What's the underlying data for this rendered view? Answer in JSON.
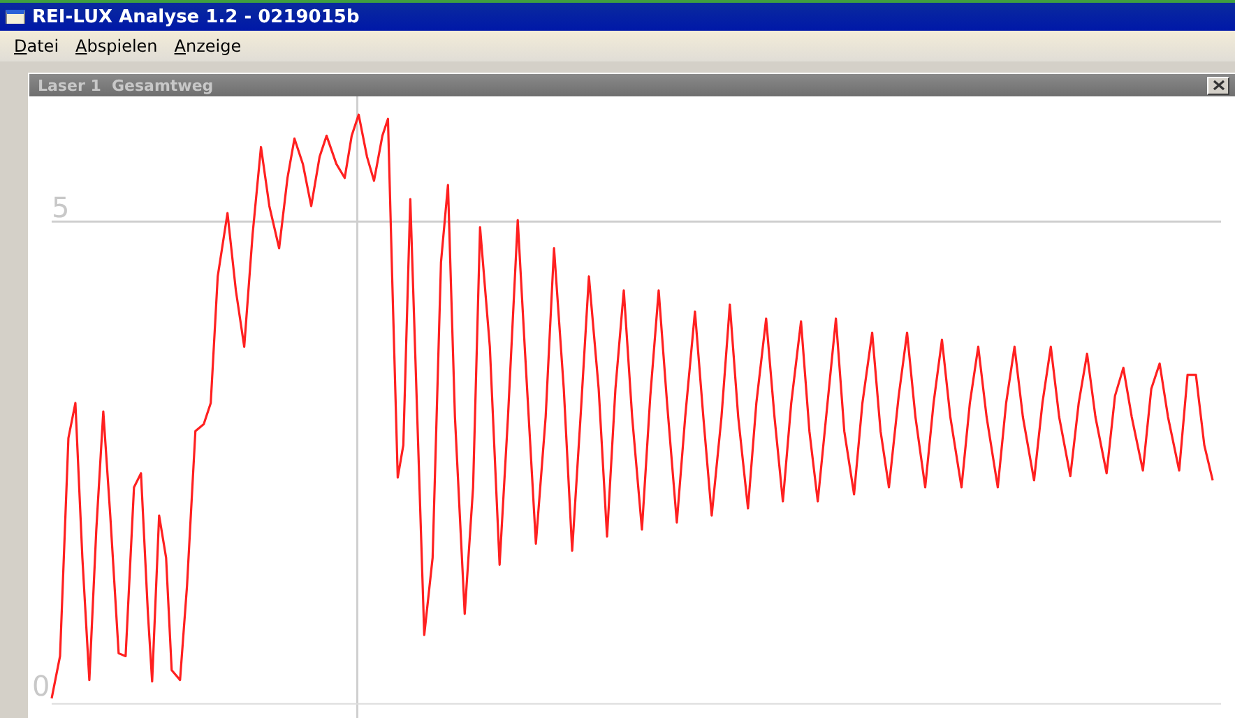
{
  "window": {
    "title": "REI-LUX Analyse 1.2 - 0219015b"
  },
  "menu": [
    {
      "label": "Datei"
    },
    {
      "label": "Abspielen"
    },
    {
      "label": "Anzeige"
    }
  ],
  "child_window": {
    "title": "Laser 1  Gesamtweg",
    "axis_labels": [
      "5",
      "0"
    ]
  }
}
